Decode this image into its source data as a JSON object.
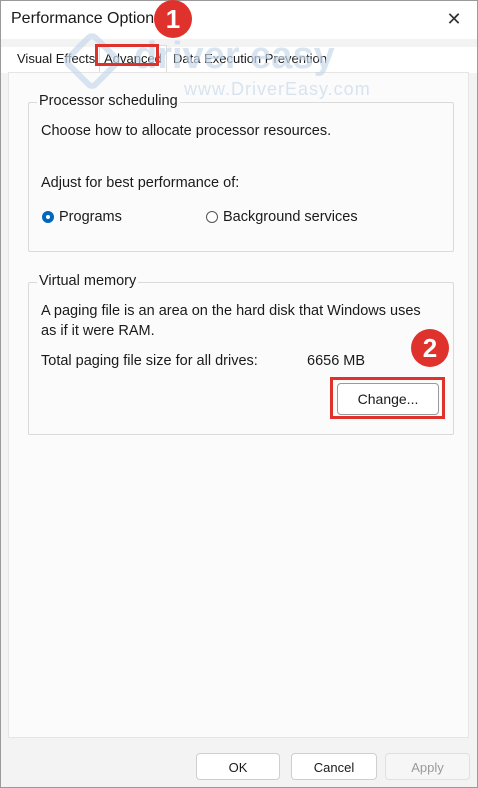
{
  "window": {
    "title": "Performance Options",
    "close_glyph": "✕"
  },
  "tabs": [
    {
      "label": "Visual Effects"
    },
    {
      "label": "Advanced"
    },
    {
      "label": "Data Execution Prevention"
    }
  ],
  "watermark": {
    "brand": "driver easy",
    "url": "www.DriverEasy.com"
  },
  "processor_scheduling": {
    "label": "Processor scheduling",
    "description": "Choose how to allocate processor resources.",
    "adjust_label": "Adjust for best performance of:",
    "options": [
      {
        "label": "Programs",
        "selected": true
      },
      {
        "label": "Background services",
        "selected": false
      }
    ]
  },
  "virtual_memory": {
    "label": "Virtual memory",
    "description_line1": "A paging file is an area on the hard disk that Windows uses",
    "description_line2": "as if it were RAM.",
    "total_label": "Total paging file size for all drives:",
    "total_value": "6656 MB",
    "change_label": "Change..."
  },
  "annotations": {
    "step1": "1",
    "step2": "2",
    "highlight_color": "#e0322c"
  },
  "footer": {
    "ok_label": "OK",
    "cancel_label": "Cancel",
    "apply_label": "Apply"
  },
  "colors": {
    "accent": "#0067c0"
  }
}
